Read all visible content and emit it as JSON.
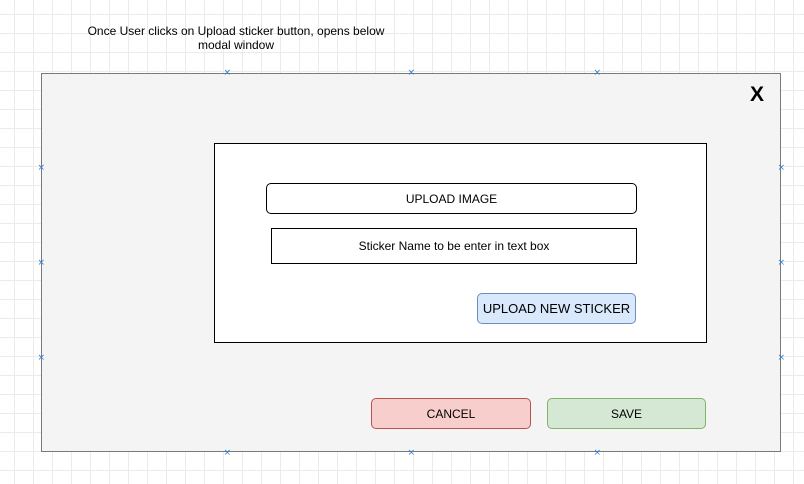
{
  "note": "Once User clicks on Upload sticker button, opens below modal window",
  "modal": {
    "close_label": "X",
    "upload_image_label": "UPLOAD IMAGE",
    "sticker_name_placeholder": "Sticker Name to be enter in text box",
    "upload_new_sticker_label": "UPLOAD NEW STICKER",
    "cancel_label": "CANCEL",
    "save_label": "SAVE"
  },
  "colors": {
    "modal_bg": "#f4f4f4",
    "upload_new_fill": "#dae8fc",
    "cancel_fill": "#f8cecc",
    "save_fill": "#d5e8d4",
    "selection_handle": "#2d7bd3"
  },
  "handle_glyph": "×"
}
